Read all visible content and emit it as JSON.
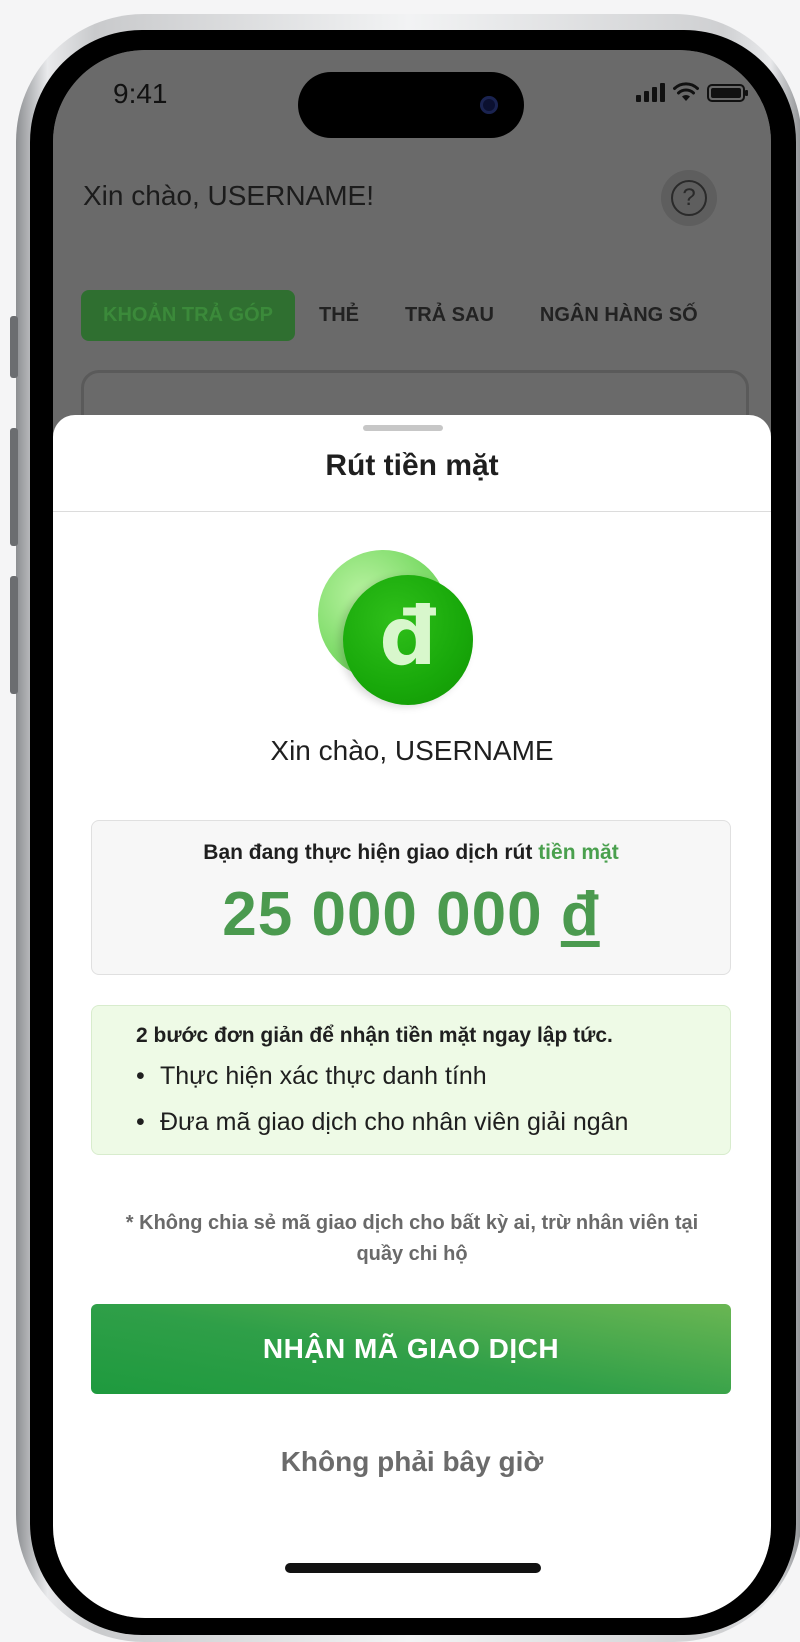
{
  "status_bar": {
    "time": "9:41",
    "icons": [
      "cellular-signal-icon",
      "wifi-icon",
      "battery-icon"
    ]
  },
  "background_app": {
    "greeting": "Xin chào, USERNAME!",
    "help_icon": "question-circle-icon",
    "help_glyph": "?",
    "tabs": [
      {
        "label": "KHOẢN TRẢ GÓP",
        "active": true
      },
      {
        "label": "THẺ",
        "active": false
      },
      {
        "label": "TRẢ SAU",
        "active": false
      },
      {
        "label": "NGÂN HÀNG SỐ",
        "active": false
      }
    ]
  },
  "sheet": {
    "title": "Rút tiền mặt",
    "coin_icon": "dong-coin-icon",
    "coin_symbol": "đ",
    "hello": "Xin chào, USERNAME",
    "amount_card": {
      "caption_prefix": "Bạn đang thực hiện giao dịch rút",
      "caption_highlight": "tiền mặt",
      "amount": "25 000 000",
      "currency": "đ"
    },
    "steps": {
      "title": "2 bước đơn giản để nhận tiền mặt ngay lập tức.",
      "bullet": "•",
      "items": [
        "Thực hiện xác thực danh tính",
        "Đưa mã giao dịch cho nhân viên giải ngân"
      ]
    },
    "warning": "* Không chia sẻ mã giao dịch cho bất kỳ ai, trừ nhân viên tại quầy chi hộ",
    "primary_button": "NHẬN MÃ GIAO DỊCH",
    "secondary_button": "Không phải bây giờ"
  },
  "colors": {
    "accent_green": "#4b9a4f",
    "button_gradient_start": "#1e9a3e",
    "button_gradient_end": "#6ab653",
    "steps_background": "#eefae6"
  }
}
